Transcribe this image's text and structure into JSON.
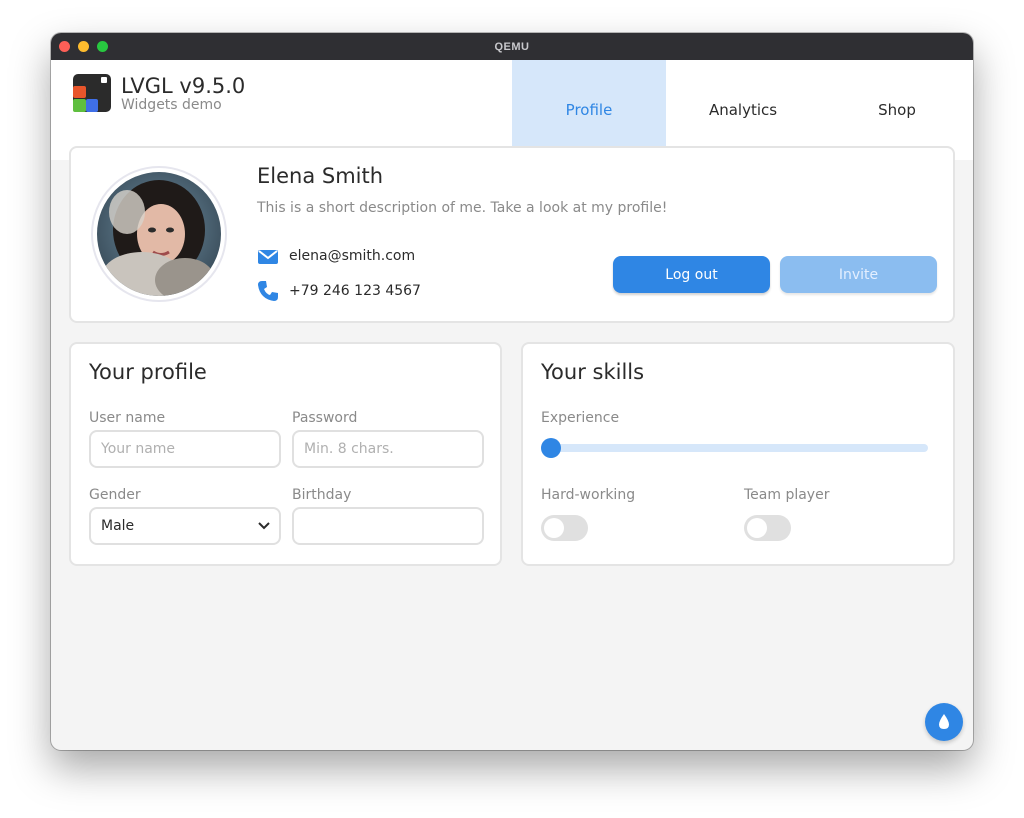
{
  "window": {
    "title": "QEMU"
  },
  "app": {
    "title": "LVGL v9.5.0",
    "subtitle": "Widgets demo"
  },
  "tabs": [
    {
      "label": "Profile",
      "active": true
    },
    {
      "label": "Analytics",
      "active": false
    },
    {
      "label": "Shop",
      "active": false
    }
  ],
  "profile_card": {
    "name": "Elena Smith",
    "description": "This is a short description of me. Take a look at my profile!",
    "email": "elena@smith.com",
    "phone": "+79 246 123 4567",
    "logout_label": "Log out",
    "invite_label": "Invite"
  },
  "your_profile": {
    "title": "Your profile",
    "username_label": "User name",
    "username_placeholder": "Your name",
    "password_label": "Password",
    "password_placeholder": "Min. 8 chars.",
    "gender_label": "Gender",
    "gender_value": "Male",
    "birthday_label": "Birthday",
    "birthday_value": ""
  },
  "your_skills": {
    "title": "Your skills",
    "experience_label": "Experience",
    "experience_value": 0,
    "hardworking_label": "Hard-working",
    "hardworking_on": false,
    "teamplayer_label": "Team player",
    "teamplayer_on": false
  },
  "colors": {
    "accent": "#2f86e4",
    "accent_light": "#d6e7fa",
    "text": "#2b2b2b",
    "muted": "#8a8a8a",
    "background": "#f4f4f4"
  },
  "icons": {
    "email": "envelope-icon",
    "phone": "phone-icon",
    "dropdown": "chevron-down-icon",
    "theme": "water-drop-icon"
  }
}
